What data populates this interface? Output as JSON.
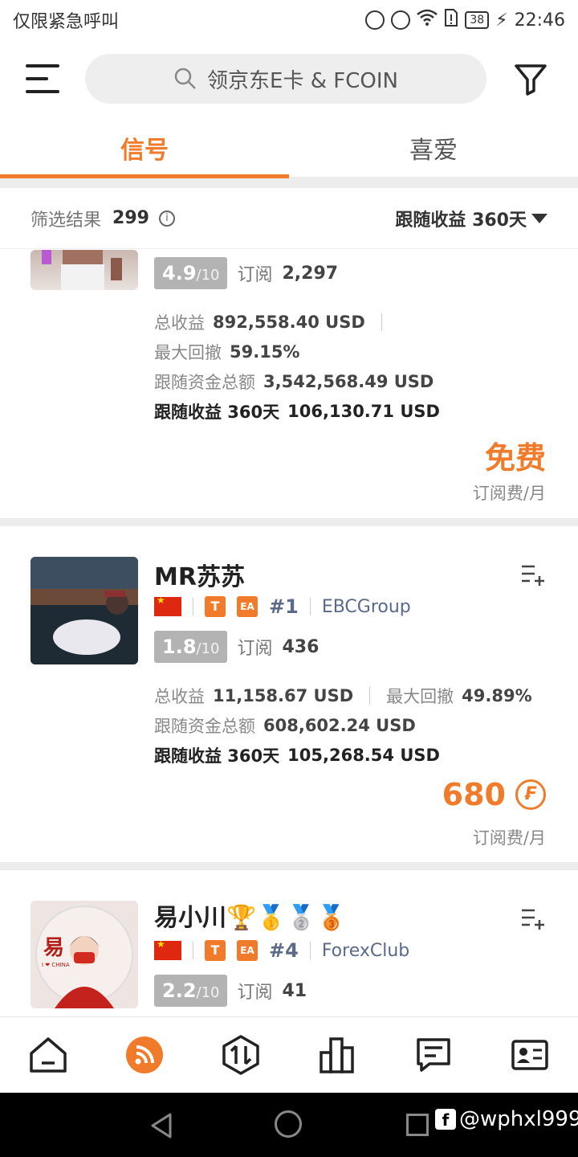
{
  "status_bar": {
    "emergency_text": "仅限紧急呼叫",
    "battery": "38",
    "time": "22:46"
  },
  "search": {
    "placeholder": "领京东E卡 & FCOIN"
  },
  "tabs": [
    {
      "label": "信号",
      "active": true
    },
    {
      "label": "喜爱",
      "active": false
    }
  ],
  "filter": {
    "label": "筛选结果",
    "count": "299",
    "sort_label": "跟随收益 360天"
  },
  "cards": [
    {
      "score": "4.9",
      "score_max": "/10",
      "subs_label": "订阅",
      "subs": "2,297",
      "total_profit_label": "总收益",
      "total_profit": "892,558.40 USD",
      "max_dd_label": "最大回撤",
      "max_dd": "59.15%",
      "follow_funds_label": "跟随资金总额",
      "follow_funds": "3,542,568.49 USD",
      "follow_profit_label": "跟随收益 360天",
      "follow_profit": "106,130.71 USD",
      "price": "免费",
      "price_unit": "订阅费/月"
    },
    {
      "name": "MR苏苏",
      "tag_t": "T",
      "tag_ea": "EA",
      "rank": "#1",
      "broker": "EBCGroup",
      "score": "1.8",
      "score_max": "/10",
      "subs_label": "订阅",
      "subs": "436",
      "total_profit_label": "总收益",
      "total_profit": "11,158.67 USD",
      "max_dd_label": "最大回撤",
      "max_dd": "49.89%",
      "follow_funds_label": "跟随资金总额",
      "follow_funds": "608,602.24 USD",
      "follow_profit_label": "跟随收益 360天",
      "follow_profit": "105,268.54 USD",
      "price": "680",
      "price_unit": "订阅费/月",
      "coin_symbol": "₣"
    },
    {
      "name": "易小川🏆🥇🥈🥉",
      "tag_t": "T",
      "tag_ea": "EA",
      "rank": "#4",
      "broker": "ForexClub",
      "score": "2.2",
      "score_max": "/10",
      "subs_label": "订阅",
      "subs": "41",
      "avatar_text": "易",
      "avatar_sub": "I ❤ CHINA"
    }
  ],
  "watermark": {
    "text": "@wphxl999"
  },
  "colors": {
    "accent": "#f07b2a",
    "score_bg": "#b3b3b3",
    "broker": "#5a6a88"
  }
}
